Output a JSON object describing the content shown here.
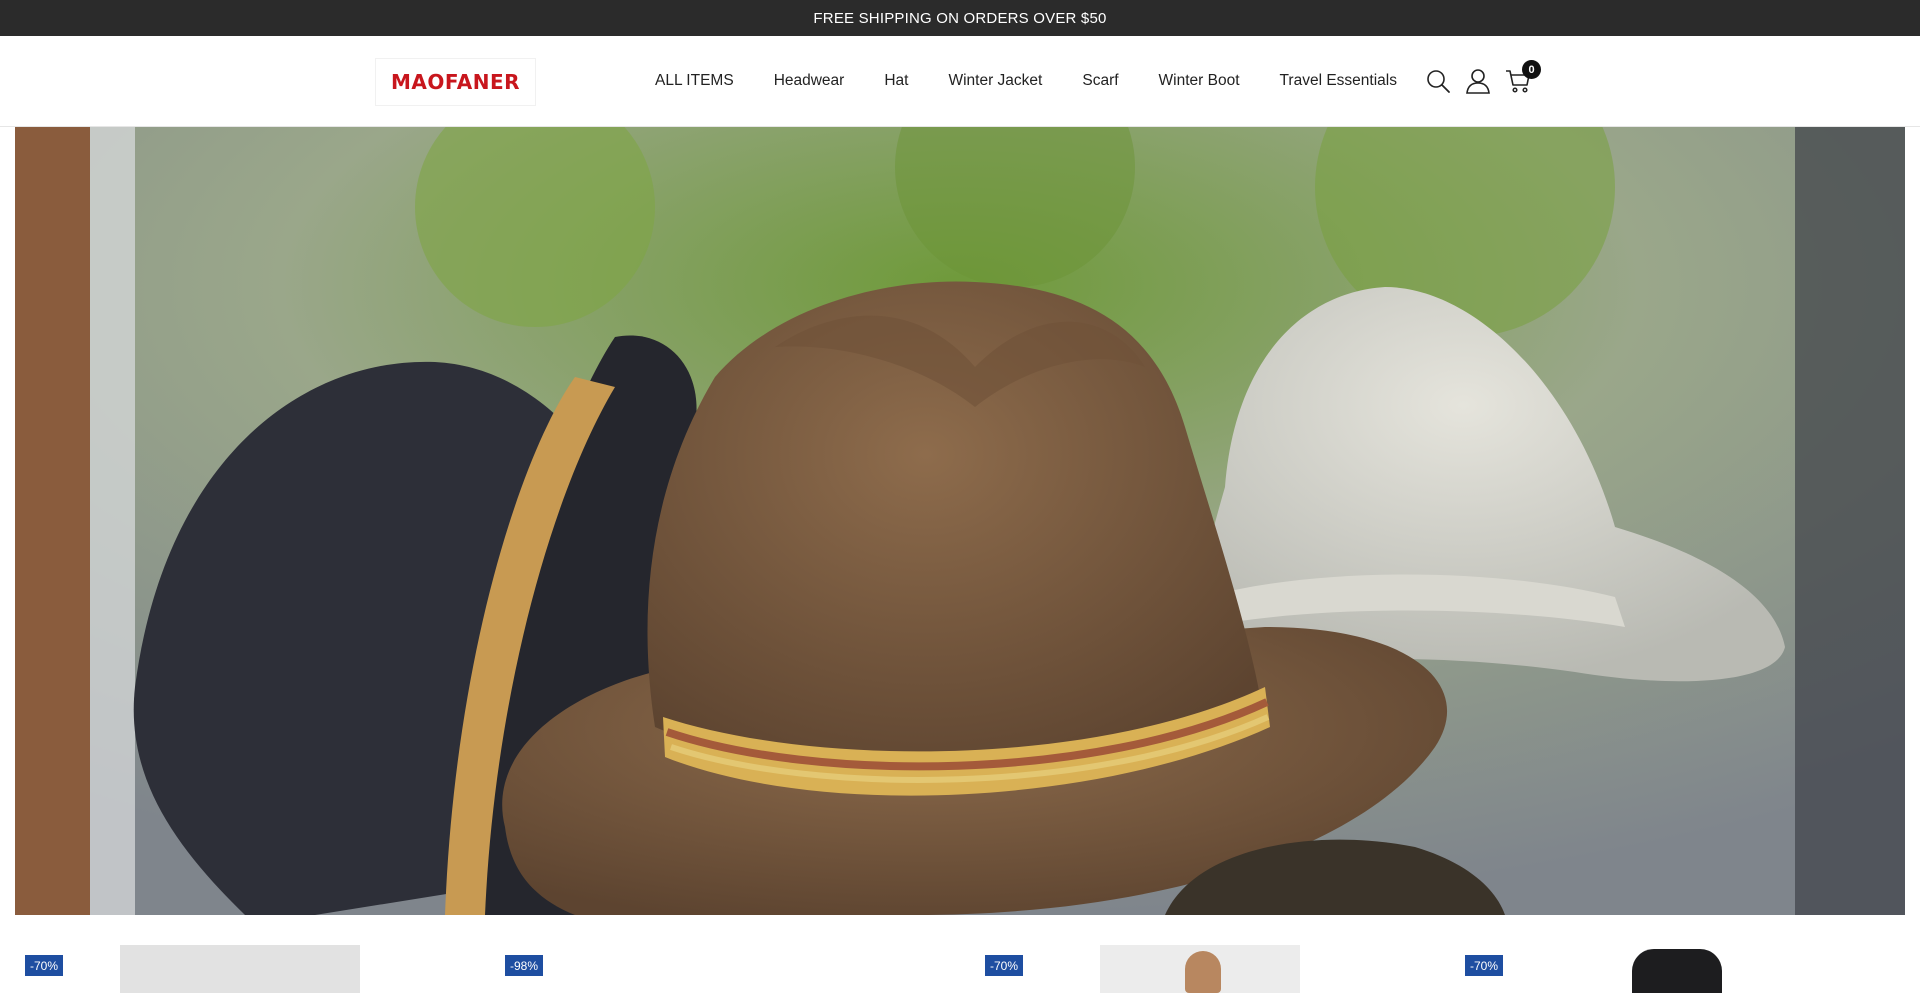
{
  "announcement": "FREE SHIPPING ON ORDERS OVER $50",
  "logo": "MAOFANER",
  "nav": [
    "ALL ITEMS",
    "Headwear",
    "Hat",
    "Winter Jacket",
    "Scarf",
    "Winter Boot",
    "Travel Essentials"
  ],
  "icons": {
    "search": "search-icon",
    "account": "user-icon",
    "cart": "cart-icon"
  },
  "cart_count": "0",
  "hero_image": "felt hats on display (brown fedora, black hat, grey hat)",
  "products": [
    {
      "badge": "-70%"
    },
    {
      "badge": "-98%"
    },
    {
      "badge": "-70%"
    },
    {
      "badge": "-70%"
    }
  ],
  "colors": {
    "announcement_bg": "#2b2b2b",
    "brand_red": "#c8161d",
    "badge_blue": "#1e4ea1"
  }
}
